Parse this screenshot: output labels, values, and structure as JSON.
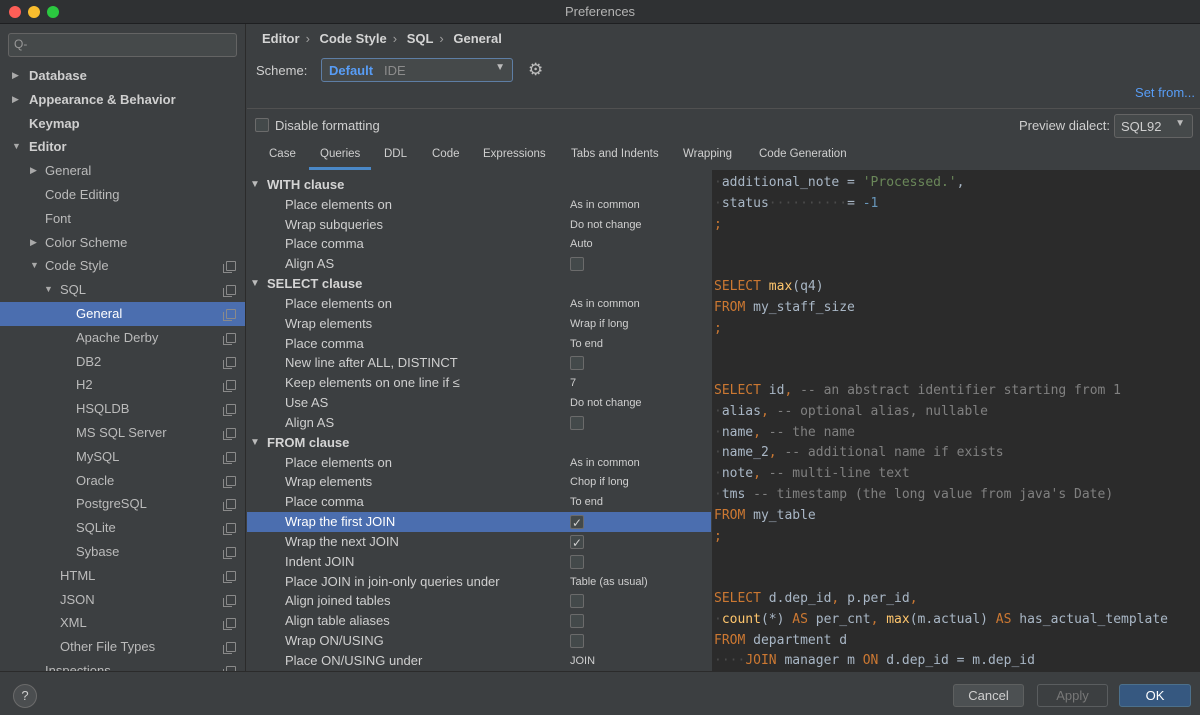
{
  "window": {
    "title": "Preferences"
  },
  "search": {
    "placeholder": "Q-"
  },
  "sidebar": {
    "items": [
      {
        "label": "Database",
        "indent": 0,
        "arrow": "▶",
        "bold": true
      },
      {
        "label": "Appearance & Behavior",
        "indent": 0,
        "arrow": "▶",
        "bold": true
      },
      {
        "label": "Keymap",
        "indent": 0,
        "arrow": "",
        "bold": true
      },
      {
        "label": "Editor",
        "indent": 0,
        "arrow": "▼",
        "bold": true
      },
      {
        "label": "General",
        "indent": 1,
        "arrow": "▶"
      },
      {
        "label": "Code Editing",
        "indent": 1,
        "arrow": ""
      },
      {
        "label": "Font",
        "indent": 1,
        "arrow": ""
      },
      {
        "label": "Color Scheme",
        "indent": 1,
        "arrow": "▶"
      },
      {
        "label": "Code Style",
        "indent": 1,
        "arrow": "▼",
        "copy": true
      },
      {
        "label": "SQL",
        "indent": 2,
        "arrow": "▼",
        "copy": true
      },
      {
        "label": "General",
        "indent": 3,
        "arrow": "",
        "copy": true,
        "selected": true
      },
      {
        "label": "Apache Derby",
        "indent": 3,
        "arrow": "",
        "copy": true
      },
      {
        "label": "DB2",
        "indent": 3,
        "arrow": "",
        "copy": true
      },
      {
        "label": "H2",
        "indent": 3,
        "arrow": "",
        "copy": true
      },
      {
        "label": "HSQLDB",
        "indent": 3,
        "arrow": "",
        "copy": true
      },
      {
        "label": "MS SQL Server",
        "indent": 3,
        "arrow": "",
        "copy": true
      },
      {
        "label": "MySQL",
        "indent": 3,
        "arrow": "",
        "copy": true
      },
      {
        "label": "Oracle",
        "indent": 3,
        "arrow": "",
        "copy": true
      },
      {
        "label": "PostgreSQL",
        "indent": 3,
        "arrow": "",
        "copy": true
      },
      {
        "label": "SQLite",
        "indent": 3,
        "arrow": "",
        "copy": true
      },
      {
        "label": "Sybase",
        "indent": 3,
        "arrow": "",
        "copy": true
      },
      {
        "label": "HTML",
        "indent": 2,
        "arrow": "",
        "copy": true
      },
      {
        "label": "JSON",
        "indent": 2,
        "arrow": "",
        "copy": true
      },
      {
        "label": "XML",
        "indent": 2,
        "arrow": "",
        "copy": true
      },
      {
        "label": "Other File Types",
        "indent": 2,
        "arrow": "",
        "copy": true
      },
      {
        "label": "Inspections",
        "indent": 1,
        "arrow": "",
        "copy": true
      }
    ]
  },
  "header": {
    "breadcrumb": [
      "Editor",
      "Code Style",
      "SQL",
      "General"
    ],
    "scheme_label": "Scheme:",
    "scheme_value": "Default",
    "scheme_sub": "IDE",
    "set_from": "Set from..."
  },
  "formatting": {
    "disable_label": "Disable formatting",
    "disable_checked": false,
    "dialect_label": "Preview dialect:",
    "dialect_value": "SQL92"
  },
  "tabs": [
    "Case",
    "Queries",
    "DDL",
    "Code",
    "Expressions",
    "Tabs and Indents",
    "Wrapping",
    "Code Generation"
  ],
  "active_tab": "Queries",
  "options": [
    {
      "type": "section",
      "name": "WITH clause"
    },
    {
      "type": "opt",
      "name": "Place elements on",
      "value": "As in common"
    },
    {
      "type": "opt",
      "name": "Wrap subqueries",
      "value": "Do not change"
    },
    {
      "type": "opt",
      "name": "Place comma",
      "value": "Auto"
    },
    {
      "type": "opt",
      "name": "Align AS",
      "check": false
    },
    {
      "type": "section",
      "name": "SELECT clause"
    },
    {
      "type": "opt",
      "name": "Place elements on",
      "value": "As in common"
    },
    {
      "type": "opt",
      "name": "Wrap elements",
      "value": "Wrap if long"
    },
    {
      "type": "opt",
      "name": "Place comma",
      "value": "To end"
    },
    {
      "type": "opt",
      "name": "New line after ALL, DISTINCT",
      "check": false
    },
    {
      "type": "opt",
      "name": "Keep elements on one line if ≤",
      "value": "7"
    },
    {
      "type": "opt",
      "name": "Use AS",
      "value": "Do not change"
    },
    {
      "type": "opt",
      "name": "Align AS",
      "check": false
    },
    {
      "type": "section",
      "name": "FROM clause"
    },
    {
      "type": "opt",
      "name": "Place elements on",
      "value": "As in common"
    },
    {
      "type": "opt",
      "name": "Wrap elements",
      "value": "Chop if long"
    },
    {
      "type": "opt",
      "name": "Place comma",
      "value": "To end"
    },
    {
      "type": "opt",
      "name": "Wrap the first JOIN",
      "check": true,
      "selected": true
    },
    {
      "type": "opt",
      "name": "Wrap the next JOIN",
      "check": true
    },
    {
      "type": "opt",
      "name": "Indent JOIN",
      "check": false
    },
    {
      "type": "opt",
      "name": "Place JOIN in join-only queries under",
      "value": "Table (as usual)"
    },
    {
      "type": "opt",
      "name": "Align joined tables",
      "check": false
    },
    {
      "type": "opt",
      "name": "Align table aliases",
      "check": false
    },
    {
      "type": "opt",
      "name": "Wrap ON/USING",
      "check": false
    },
    {
      "type": "opt",
      "name": "Place ON/USING under",
      "value": "JOIN"
    }
  ],
  "code": [
    [
      [
        "dot",
        "·"
      ],
      [
        "",
        "additional_note = "
      ],
      [
        "str",
        "'Processed.'"
      ],
      [
        "",
        ","
      ]
    ],
    [
      [
        "dot",
        "·"
      ],
      [
        "",
        "status"
      ],
      [
        "dot",
        "··········"
      ],
      [
        "",
        "= "
      ],
      [
        "num",
        "-1"
      ]
    ],
    [
      [
        "kw",
        ";"
      ]
    ],
    [],
    [],
    [
      [
        "kw",
        "SELECT "
      ],
      [
        "fn",
        "max"
      ],
      [
        "",
        "(q4)"
      ]
    ],
    [
      [
        "kw",
        "FROM "
      ],
      [
        "",
        "my_staff_size"
      ]
    ],
    [
      [
        "kw",
        ";"
      ]
    ],
    [],
    [],
    [
      [
        "kw",
        "SELECT "
      ],
      [
        "",
        "id"
      ],
      [
        "kw",
        ", "
      ],
      [
        "cmt",
        "-- an abstract identifier starting from 1"
      ]
    ],
    [
      [
        "dot",
        "·"
      ],
      [
        "",
        "alias"
      ],
      [
        "kw",
        ", "
      ],
      [
        "cmt",
        "-- optional alias, nullable"
      ]
    ],
    [
      [
        "dot",
        "·"
      ],
      [
        "",
        "name"
      ],
      [
        "kw",
        ", "
      ],
      [
        "cmt",
        "-- the name"
      ]
    ],
    [
      [
        "dot",
        "·"
      ],
      [
        "",
        "name_2"
      ],
      [
        "kw",
        ", "
      ],
      [
        "cmt",
        "-- additional name if exists"
      ]
    ],
    [
      [
        "dot",
        "·"
      ],
      [
        "",
        "note"
      ],
      [
        "kw",
        ", "
      ],
      [
        "cmt",
        "-- multi-line text"
      ]
    ],
    [
      [
        "dot",
        "·"
      ],
      [
        "",
        "tms "
      ],
      [
        "cmt",
        "-- timestamp (the long value from java's Date)"
      ]
    ],
    [
      [
        "kw",
        "FROM "
      ],
      [
        "",
        "my_table"
      ]
    ],
    [
      [
        "kw",
        ";"
      ]
    ],
    [],
    [],
    [
      [
        "kw",
        "SELECT "
      ],
      [
        "",
        "d.dep_id"
      ],
      [
        "kw",
        ", "
      ],
      [
        "",
        "p.per_id"
      ],
      [
        "kw",
        ","
      ]
    ],
    [
      [
        "dot",
        "·"
      ],
      [
        "fn",
        "count"
      ],
      [
        "",
        "(*) "
      ],
      [
        "kw",
        "AS "
      ],
      [
        "",
        "per_cnt"
      ],
      [
        "kw",
        ", "
      ],
      [
        "fn",
        "max"
      ],
      [
        "",
        "(m.actual) "
      ],
      [
        "kw",
        "AS "
      ],
      [
        "",
        "has_actual_template"
      ]
    ],
    [
      [
        "kw",
        "FROM "
      ],
      [
        "",
        "department d"
      ]
    ],
    [
      [
        "dot",
        "····"
      ],
      [
        "kw",
        "JOIN "
      ],
      [
        "",
        "manager m "
      ],
      [
        "kw",
        "ON "
      ],
      [
        "",
        "d.dep_id = m.dep_id"
      ]
    ]
  ],
  "buttons": {
    "help": "?",
    "cancel": "Cancel",
    "apply": "Apply",
    "ok": "OK"
  }
}
